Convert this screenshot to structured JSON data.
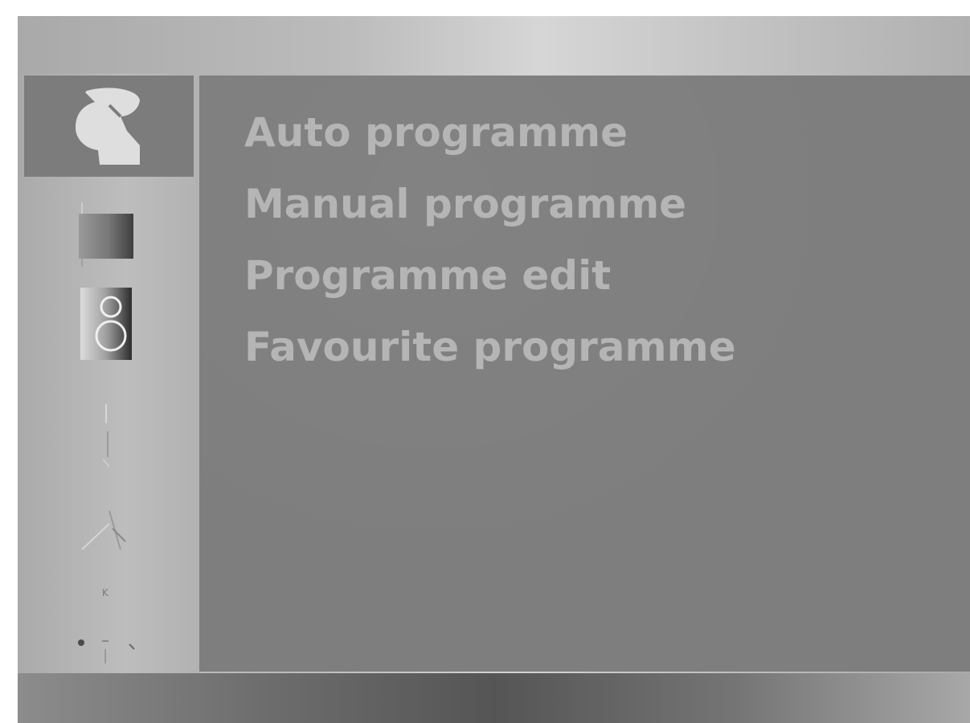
{
  "osd_menu": {
    "categories": [
      {
        "icon": "satellite-dish-icon",
        "selected": true
      },
      {
        "icon": "picture-icon",
        "selected": false
      },
      {
        "icon": "speaker-icon",
        "selected": false
      },
      {
        "icon": "clock-icon",
        "selected": false
      },
      {
        "icon": "special-icon",
        "selected": false
      }
    ],
    "items": [
      {
        "label": "Auto programme"
      },
      {
        "label": "Manual programme"
      },
      {
        "label": "Programme edit"
      },
      {
        "label": "Favourite programme"
      }
    ],
    "colors": {
      "panel_background": "#7e7e7e",
      "item_text": "#b5b5b5",
      "selected_category": "#7c7c7c"
    }
  }
}
